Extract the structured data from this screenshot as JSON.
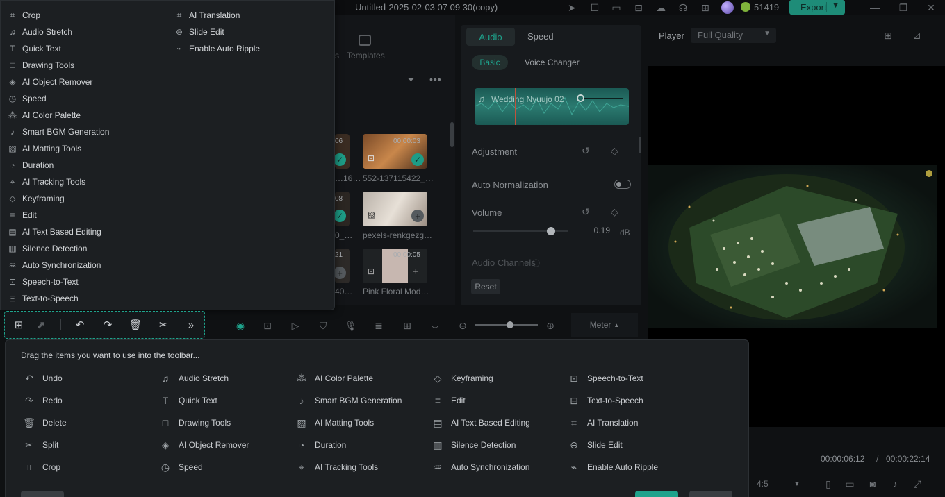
{
  "app": {
    "title": "Untitled-2025-02-03 07 09 30(copy)",
    "credits": "51419",
    "export_label": "Export"
  },
  "media": {
    "templates_label": "Templates",
    "templates_prefix": "s",
    "thumbs": [
      {
        "label": "…16…",
        "duration": "06"
      },
      {
        "label": "552-137115422_…",
        "duration": "00:00:03"
      },
      {
        "label": "0_…",
        "duration": "08"
      },
      {
        "label": "pexels-renkgezg…",
        "duration": ""
      },
      {
        "label": "40…",
        "duration": "21"
      },
      {
        "label": "Pink Floral Mod…",
        "duration": "00:00:05"
      }
    ]
  },
  "inspector": {
    "tab_audio": "Audio",
    "tab_speed": "Speed",
    "sub_basic": "Basic",
    "sub_voice": "Voice Changer",
    "clip_name": "Wedding Nyuujo 02",
    "adjustment": "Adjustment",
    "auto_normalization": "Auto Normalization",
    "volume": "Volume",
    "volume_value": "0.19",
    "volume_unit": "dB",
    "audio_channels": "Audio Channels",
    "reset": "Reset"
  },
  "player": {
    "label": "Player",
    "quality": "Full Quality",
    "time_current": "00:00:06:12",
    "time_separator": "/",
    "time_total": "00:00:22:14",
    "ratio": "4:5"
  },
  "timeline": {
    "meter": "Meter"
  },
  "menu": {
    "col1": [
      {
        "icon": "crop-icon",
        "glyph": "⌗",
        "label": "Crop"
      },
      {
        "icon": "audio-stretch-icon",
        "glyph": "♫",
        "label": "Audio Stretch"
      },
      {
        "icon": "quick-text-icon",
        "glyph": "T",
        "label": "Quick Text"
      },
      {
        "icon": "drawing-tools-icon",
        "glyph": "□",
        "label": "Drawing Tools"
      },
      {
        "icon": "ai-object-remover-icon",
        "glyph": "◈",
        "label": "AI Object Remover"
      },
      {
        "icon": "speed-icon",
        "glyph": "◷",
        "label": "Speed"
      },
      {
        "icon": "ai-color-palette-icon",
        "glyph": "⁂",
        "label": "AI Color Palette"
      },
      {
        "icon": "smart-bgm-icon",
        "glyph": "♪",
        "label": "Smart BGM Generation"
      },
      {
        "icon": "ai-matting-icon",
        "glyph": "▨",
        "label": "AI Matting Tools"
      },
      {
        "icon": "duration-icon",
        "glyph": "◔",
        "label": "Duration"
      },
      {
        "icon": "ai-tracking-icon",
        "glyph": "⌖",
        "label": "AI Tracking Tools"
      },
      {
        "icon": "keyframing-icon",
        "glyph": "◇",
        "label": "Keyframing"
      },
      {
        "icon": "edit-icon",
        "glyph": "≡",
        "label": "Edit"
      },
      {
        "icon": "ai-text-editing-icon",
        "glyph": "▤",
        "label": "AI Text Based Editing"
      },
      {
        "icon": "silence-detection-icon",
        "glyph": "▥",
        "label": "Silence Detection"
      },
      {
        "icon": "auto-sync-icon",
        "glyph": "♒",
        "label": "Auto Synchronization"
      },
      {
        "icon": "speech-to-text-icon",
        "glyph": "⊡",
        "label": "Speech-to-Text"
      },
      {
        "icon": "text-to-speech-icon",
        "glyph": "⊟",
        "label": "Text-to-Speech"
      }
    ],
    "col2": [
      {
        "icon": "ai-translation-icon",
        "glyph": "⌗",
        "label": "AI Translation"
      },
      {
        "icon": "slide-edit-icon",
        "glyph": "⊖",
        "label": "Slide Edit"
      },
      {
        "icon": "enable-auto-ripple-icon",
        "glyph": "⌁",
        "label": "Enable Auto Ripple"
      }
    ]
  },
  "drag": {
    "title": "Drag the items you want to use into the toolbar...",
    "columns": [
      [
        {
          "icon": "undo-icon",
          "glyph": "↶",
          "label": "Undo"
        },
        {
          "icon": "redo-icon",
          "glyph": "↷",
          "label": "Redo"
        },
        {
          "icon": "delete-icon",
          "glyph": "🗑",
          "label": "Delete"
        },
        {
          "icon": "split-icon",
          "glyph": "✂",
          "label": "Split"
        },
        {
          "icon": "crop-icon",
          "glyph": "⌗",
          "label": "Crop"
        }
      ],
      [
        {
          "icon": "audio-stretch-icon",
          "glyph": "♫",
          "label": "Audio Stretch"
        },
        {
          "icon": "quick-text-icon",
          "glyph": "T",
          "label": "Quick Text"
        },
        {
          "icon": "drawing-tools-icon",
          "glyph": "□",
          "label": "Drawing Tools"
        },
        {
          "icon": "ai-object-remover-icon",
          "glyph": "◈",
          "label": "AI Object Remover"
        },
        {
          "icon": "speed-icon",
          "glyph": "◷",
          "label": "Speed"
        }
      ],
      [
        {
          "icon": "ai-color-palette-icon",
          "glyph": "⁂",
          "label": "AI Color Palette"
        },
        {
          "icon": "smart-bgm-icon",
          "glyph": "♪",
          "label": "Smart BGM Generation"
        },
        {
          "icon": "ai-matting-icon",
          "glyph": "▨",
          "label": "AI Matting Tools"
        },
        {
          "icon": "duration-icon",
          "glyph": "◔",
          "label": "Duration"
        },
        {
          "icon": "ai-tracking-icon",
          "glyph": "⌖",
          "label": "AI Tracking Tools"
        }
      ],
      [
        {
          "icon": "keyframing-icon",
          "glyph": "◇",
          "label": "Keyframing"
        },
        {
          "icon": "edit-icon",
          "glyph": "≡",
          "label": "Edit"
        },
        {
          "icon": "ai-text-editing-icon",
          "glyph": "▤",
          "label": "AI Text Based Editing"
        },
        {
          "icon": "silence-detection-icon",
          "glyph": "▥",
          "label": "Silence Detection"
        },
        {
          "icon": "auto-sync-icon",
          "glyph": "♒",
          "label": "Auto Synchronization"
        }
      ],
      [
        {
          "icon": "speech-to-text-icon",
          "glyph": "⊡",
          "label": "Speech-to-Text"
        },
        {
          "icon": "text-to-speech-icon",
          "glyph": "⊟",
          "label": "Text-to-Speech"
        },
        {
          "icon": "ai-translation-icon",
          "glyph": "⌗",
          "label": "AI Translation"
        },
        {
          "icon": "slide-edit-icon",
          "glyph": "⊖",
          "label": "Slide Edit"
        },
        {
          "icon": "enable-auto-ripple-icon",
          "glyph": "⌁",
          "label": "Enable Auto Ripple"
        }
      ]
    ]
  },
  "colors": {
    "accent": "#1ea38c",
    "export": "#1e8c78"
  }
}
